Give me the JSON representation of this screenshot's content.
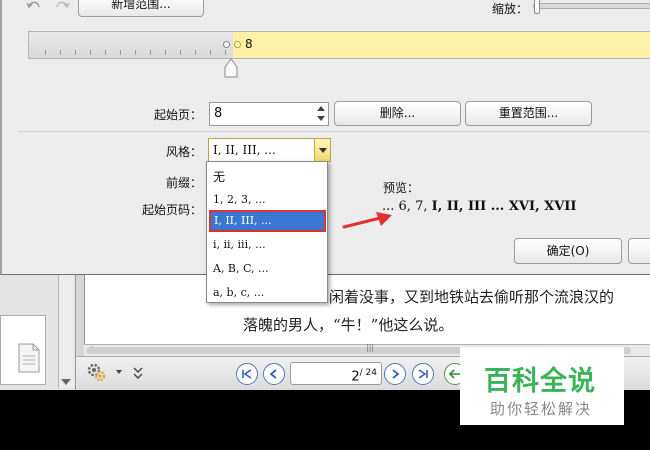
{
  "toolbar": {
    "add_range_label": "新增范围...",
    "zoom_label": "缩放："
  },
  "range": {
    "marker_label": "8"
  },
  "fields": {
    "start_page_label": "起始页：",
    "start_page_value": "8",
    "style_label": "风格：",
    "style_value": "I, II, III, ...",
    "prefix_label": "前缀：",
    "start_number_label": "起始页码：",
    "preview_label": "预览："
  },
  "buttons": {
    "delete_label": "删除...",
    "reset_label": "重置范围...",
    "ok_label": "确定(O)"
  },
  "style_options": [
    "无",
    "1, 2, 3, ...",
    "I, II, III, ...",
    "i, ii, iii, ...",
    "A, B, C, ...",
    "a, b, c, ..."
  ],
  "preview": {
    "plain": "... 6, 7, ",
    "bold": "I, II, III ... XVI, XVII"
  },
  "document": {
    "line1": "闲着没事，又到地铁站去偷听那个流浪汉的",
    "line2": "落魄的男人，“牛！”他这么说。",
    "line3": "……………………………………"
  },
  "navigation": {
    "current_page": "2",
    "total_pages": "/ 24"
  },
  "watermark": {
    "title": "百科全说",
    "subtitle": "助你轻松解决"
  },
  "colors": {
    "selection": "#3a78d4",
    "highlight_border": "#d83434",
    "range_fill": "#fdf1a5",
    "watermark_green": "#3bb35a"
  }
}
